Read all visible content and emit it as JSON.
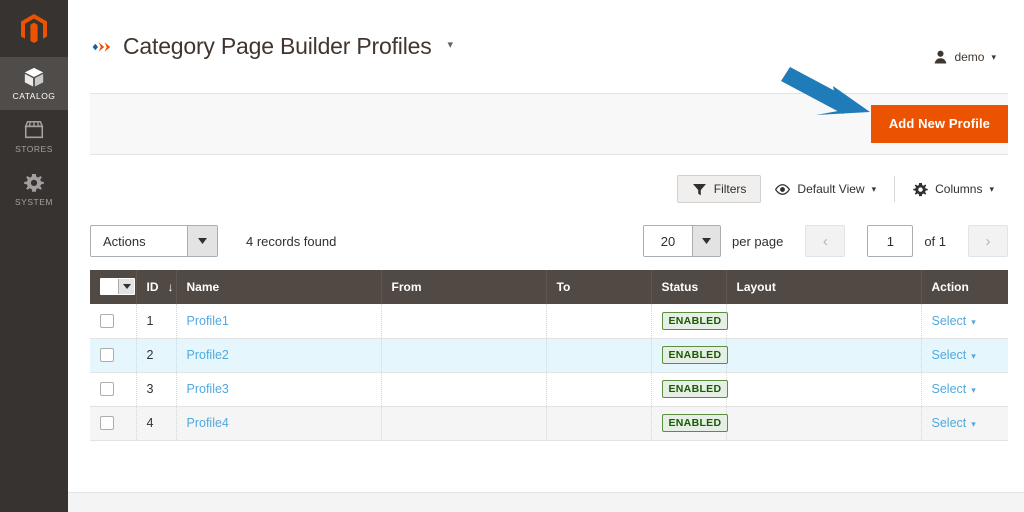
{
  "sidebar": {
    "logo_icon": "magento-logo-icon",
    "items": [
      {
        "label": "CATALOG",
        "icon": "box-icon",
        "active": true
      },
      {
        "label": "STORES",
        "icon": "store-icon",
        "active": false
      },
      {
        "label": "SYSTEM",
        "icon": "gear-icon",
        "active": false
      }
    ]
  },
  "header": {
    "page_icon": "page-builder-icon",
    "title": "Category Page Builder Profiles",
    "title_caret": "▾",
    "user": {
      "icon": "user-icon",
      "name": "demo",
      "caret": "▾"
    }
  },
  "page_actions": {
    "add_new_label": "Add New Profile"
  },
  "toolbar": {
    "filters_label": "Filters",
    "filters_icon": "funnel-icon",
    "view_label": "Default View",
    "view_icon": "eye-icon",
    "view_caret": "▾",
    "columns_label": "Columns",
    "columns_icon": "gear-icon",
    "columns_caret": "▾"
  },
  "controls": {
    "actions_label": "Actions",
    "actions_caret": "▾",
    "records_found": "4 records found",
    "per_page_value": "20",
    "per_page_caret": "▾",
    "per_page_label": "per page",
    "prev_icon": "‹",
    "page_value": "1",
    "of_label": "of 1",
    "next_icon": "›"
  },
  "grid": {
    "columns": [
      {
        "label": "",
        "key": "checkbox"
      },
      {
        "label": "ID",
        "key": "id",
        "sort": "↓"
      },
      {
        "label": "Name",
        "key": "name"
      },
      {
        "label": "From",
        "key": "from"
      },
      {
        "label": "To",
        "key": "to"
      },
      {
        "label": "Status",
        "key": "status"
      },
      {
        "label": "Layout",
        "key": "layout"
      },
      {
        "label": "Action",
        "key": "action"
      }
    ],
    "rows": [
      {
        "id": "1",
        "name": "Profile1",
        "from": "",
        "to": "",
        "status": "ENABLED",
        "layout": "",
        "action": "Select",
        "row_style": "odd"
      },
      {
        "id": "2",
        "name": "Profile2",
        "from": "",
        "to": "",
        "status": "ENABLED",
        "layout": "",
        "action": "Select",
        "row_style": "hl"
      },
      {
        "id": "3",
        "name": "Profile3",
        "from": "",
        "to": "",
        "status": "ENABLED",
        "layout": "",
        "action": "Select",
        "row_style": "odd"
      },
      {
        "id": "4",
        "name": "Profile4",
        "from": "",
        "to": "",
        "status": "ENABLED",
        "layout": "",
        "action": "Select",
        "row_style": "even"
      }
    ],
    "action_caret": "▾"
  },
  "colors": {
    "brand_orange": "#eb5202",
    "sidebar_bg": "#373330",
    "sidebar_active": "#4f4c4a",
    "table_header": "#514943",
    "link_blue": "#53a9dd",
    "status_green": "#185b00",
    "annotation_blue": "#1f7cb8",
    "row_highlight": "#e5f7fd"
  }
}
